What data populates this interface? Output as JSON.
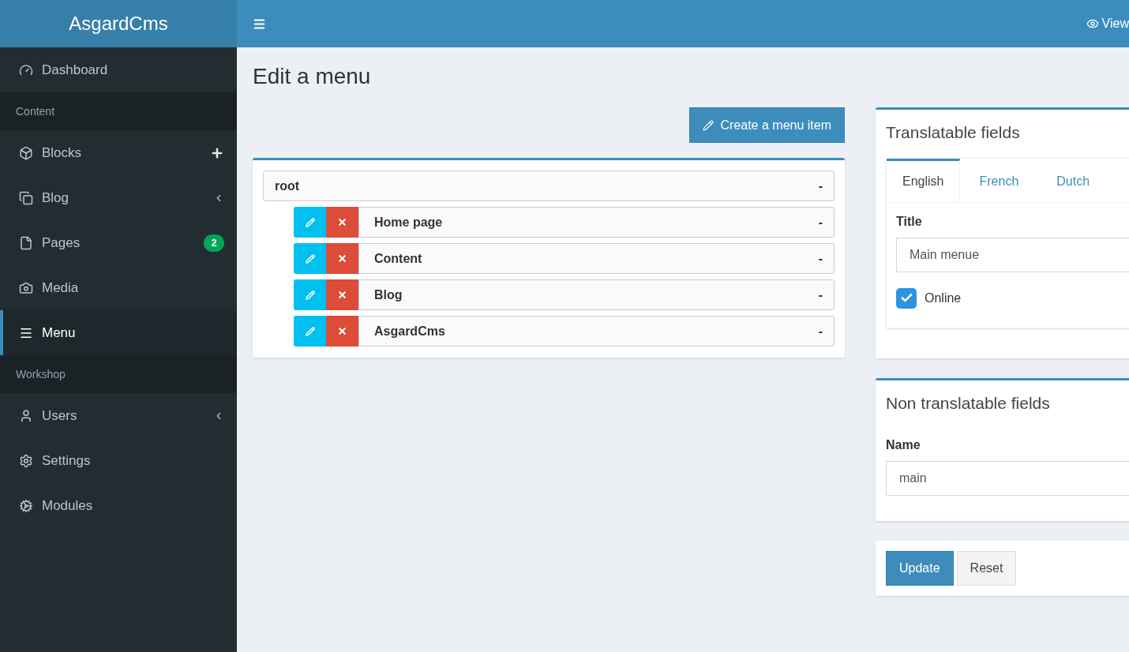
{
  "brand": "AsgardCms",
  "topbar": {
    "view_link": "View"
  },
  "sidebar": [
    {
      "kind": "item",
      "label": "Dashboard",
      "selected": false
    },
    {
      "kind": "header",
      "label": "Content"
    },
    {
      "kind": "item",
      "label": "Blocks",
      "selected": false
    },
    {
      "kind": "item",
      "label": "Blog",
      "selected": false
    },
    {
      "kind": "item",
      "label": "Pages",
      "badge": "2",
      "selected": false
    },
    {
      "kind": "item",
      "label": "Media",
      "selected": false
    },
    {
      "kind": "item",
      "label": "Menu",
      "selected": true
    },
    {
      "kind": "header",
      "label": "Workshop"
    },
    {
      "kind": "item",
      "label": "Users",
      "selected": false
    },
    {
      "kind": "item",
      "label": "Settings",
      "selected": false
    },
    {
      "kind": "item",
      "label": "Modules",
      "selected": false
    }
  ],
  "page_title": "Edit a menu",
  "create_button": "Create a menu item",
  "tree": {
    "label": "root",
    "collapse": "-",
    "children": [
      {
        "label": "Home page",
        "collapse": "-"
      },
      {
        "label": "Content",
        "collapse": "-"
      },
      {
        "label": "Blog",
        "collapse": "-"
      },
      {
        "label": "AsgardCms",
        "collapse": "-"
      }
    ]
  },
  "translatable": {
    "title": "Translatable fields",
    "tabs": [
      {
        "label": "English",
        "selected": true
      },
      {
        "label": "French",
        "selected": false
      },
      {
        "label": "Dutch",
        "selected": false
      }
    ],
    "title_label": "Title",
    "title_value": "Main menue",
    "online_label": "Online",
    "online_checked": true
  },
  "non_translatable": {
    "title": "Non translatable fields",
    "name_label": "Name",
    "name_value": "main"
  },
  "actions": {
    "update": "Update",
    "reset": "Reset"
  }
}
